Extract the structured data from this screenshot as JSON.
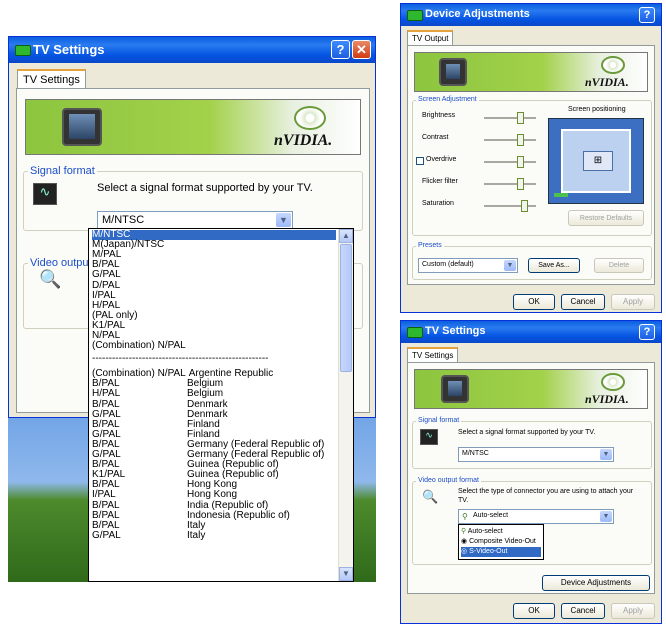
{
  "main_window": {
    "title": "TV Settings",
    "tab": "TV Settings",
    "brand": "nVIDIA.",
    "signal_format_group": "Signal format",
    "signal_instruction": "Select a signal format supported by your TV.",
    "signal_value": "M/NTSC",
    "video_output_group": "Video output",
    "dropdown_items": [
      "M/NTSC",
      "M(Japan)/NTSC",
      "M/PAL",
      "B/PAL",
      "G/PAL",
      "D/PAL",
      "I/PAL",
      "H/PAL",
      "(PAL only)",
      "K1/PAL",
      "N/PAL",
      "(Combination) N/PAL"
    ],
    "separator": "-----------------------------------------------------",
    "country_items": [
      {
        "format": "(Combination) N/PAL",
        "country": "Argentine Republic"
      },
      {
        "format": "B/PAL",
        "country": "Belgium"
      },
      {
        "format": "H/PAL",
        "country": "Belgium"
      },
      {
        "format": "B/PAL",
        "country": "Denmark"
      },
      {
        "format": "G/PAL",
        "country": "Denmark"
      },
      {
        "format": "B/PAL",
        "country": "Finland"
      },
      {
        "format": "G/PAL",
        "country": "Finland"
      },
      {
        "format": "B/PAL",
        "country": "Germany (Federal Republic of)"
      },
      {
        "format": "G/PAL",
        "country": "Germany (Federal Republic of)"
      },
      {
        "format": "B/PAL",
        "country": "Guinea (Republic of)"
      },
      {
        "format": "K1/PAL",
        "country": "Guinea (Republic of)"
      },
      {
        "format": "B/PAL",
        "country": "Hong Kong"
      },
      {
        "format": "I/PAL",
        "country": "Hong Kong"
      },
      {
        "format": "B/PAL",
        "country": "India (Republic of)"
      },
      {
        "format": "B/PAL",
        "country": "Indonesia (Republic of)"
      },
      {
        "format": "B/PAL",
        "country": "Italy"
      },
      {
        "format": "G/PAL",
        "country": "Italy"
      }
    ]
  },
  "device_window": {
    "title": "Device Adjustments",
    "tab": "TV Output",
    "brand": "nVIDIA.",
    "screen_adjustment_group": "Screen Adjustment",
    "sliders": [
      "Brightness",
      "Contrast",
      "Overdrive",
      "Flicker filter",
      "Saturation"
    ],
    "screen_positioning": "Screen positioning",
    "restore_defaults": "Restore Defaults",
    "presets_group": "Presets",
    "preset_value": "Custom (default)",
    "save_as": "Save As...",
    "delete": "Delete",
    "ok": "OK",
    "cancel": "Cancel",
    "apply": "Apply"
  },
  "tv_window2": {
    "title": "TV Settings",
    "tab": "TV Settings",
    "brand": "nVIDIA.",
    "signal_format_group": "Signal format",
    "signal_instruction": "Select a signal format supported by your TV.",
    "signal_value": "M/NTSC",
    "video_output_group": "Video output format",
    "video_instruction": "Select the type of connector you are using to attach your TV.",
    "output_value": "Auto-select",
    "output_options": [
      "Auto-select",
      "Composite Video-Out",
      "S-Video-Out"
    ],
    "device_adjustments": "Device Adjustments",
    "ok": "OK",
    "cancel": "Cancel",
    "apply": "Apply"
  }
}
